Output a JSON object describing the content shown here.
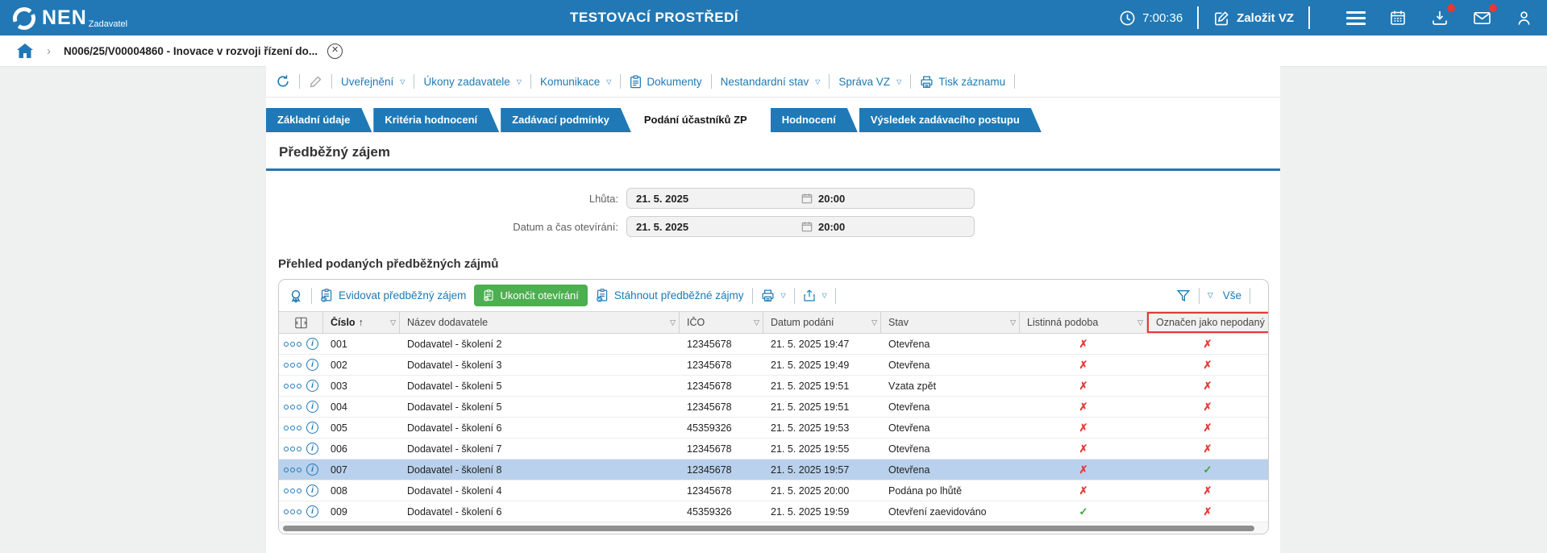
{
  "header": {
    "logo": "NEN",
    "logo_sub": "Zadavatel",
    "env_title": "TESTOVACÍ PROSTŘEDÍ",
    "clock": "7:00:36",
    "create_label": "Založit VZ"
  },
  "breadcrumb": {
    "title": "N006/25/V00004860 - Inovace v rozvoji řízení do..."
  },
  "panel_toolbar": {
    "items": [
      {
        "label": "Uveřejnění",
        "caret": true
      },
      {
        "label": "Úkony zadavatele",
        "caret": true
      },
      {
        "label": "Komunikace",
        "caret": true
      },
      {
        "label": "Dokumenty",
        "caret": false
      },
      {
        "label": "Nestandardní stav",
        "caret": true
      },
      {
        "label": "Správa VZ",
        "caret": true
      },
      {
        "label": "Tisk záznamu",
        "caret": false
      }
    ]
  },
  "tabs": [
    {
      "label": "Základní údaje",
      "active": false
    },
    {
      "label": "Kritéria hodnocení",
      "active": false
    },
    {
      "label": "Zadávací podmínky",
      "active": false
    },
    {
      "label": "Podání účastníků ZP",
      "active": true
    },
    {
      "label": "Hodnocení",
      "active": false
    },
    {
      "label": "Výsledek zadávacího postupu",
      "active": false
    }
  ],
  "sections": {
    "interest_title": "Předběžný zájem",
    "list_title": "Přehled podaných předběžných zájmů"
  },
  "form": {
    "rows": [
      {
        "label": "Lhůta:",
        "date": "21. 5. 2025",
        "time": "20:00"
      },
      {
        "label": "Datum a čas otevírání:",
        "date": "21. 5. 2025",
        "time": "20:00"
      }
    ]
  },
  "card": {
    "toolbar": {
      "register": "Evidovat předběžný zájem",
      "finish": "Ukončit otevírání",
      "download": "Stáhnout předběžné zájmy",
      "all_label": "Vše"
    }
  },
  "table": {
    "columns": [
      {
        "label": "Číslo",
        "sorted": "asc",
        "highlighted": false
      },
      {
        "label": "Název dodavatele",
        "sorted": null,
        "highlighted": false
      },
      {
        "label": "IČO",
        "sorted": null,
        "highlighted": false
      },
      {
        "label": "Datum podání",
        "sorted": null,
        "highlighted": false
      },
      {
        "label": "Stav",
        "sorted": null,
        "highlighted": false
      },
      {
        "label": "Listinná podoba",
        "sorted": null,
        "highlighted": false
      },
      {
        "label": "Označen jako nepodaný",
        "sorted": null,
        "highlighted": true
      }
    ],
    "rows": [
      {
        "cislo": "001",
        "nazev": "Dodavatel - školení 2",
        "ico": "12345678",
        "datum": "21. 5. 2025 19:47",
        "stav": "Otevřena",
        "listinna": false,
        "nepodany": false,
        "selected": false
      },
      {
        "cislo": "002",
        "nazev": "Dodavatel - školení 3",
        "ico": "12345678",
        "datum": "21. 5. 2025 19:49",
        "stav": "Otevřena",
        "listinna": false,
        "nepodany": false,
        "selected": false
      },
      {
        "cislo": "003",
        "nazev": "Dodavatel - školení 5",
        "ico": "12345678",
        "datum": "21. 5. 2025 19:51",
        "stav": "Vzata zpět",
        "listinna": false,
        "nepodany": false,
        "selected": false
      },
      {
        "cislo": "004",
        "nazev": "Dodavatel - školení 5",
        "ico": "12345678",
        "datum": "21. 5. 2025 19:51",
        "stav": "Otevřena",
        "listinna": false,
        "nepodany": false,
        "selected": false
      },
      {
        "cislo": "005",
        "nazev": "Dodavatel - školení 6",
        "ico": "45359326",
        "datum": "21. 5. 2025 19:53",
        "stav": "Otevřena",
        "listinna": false,
        "nepodany": false,
        "selected": false
      },
      {
        "cislo": "006",
        "nazev": "Dodavatel - školení 7",
        "ico": "12345678",
        "datum": "21. 5. 2025 19:55",
        "stav": "Otevřena",
        "listinna": false,
        "nepodany": false,
        "selected": false
      },
      {
        "cislo": "007",
        "nazev": "Dodavatel - školení 8",
        "ico": "12345678",
        "datum": "21. 5. 2025 19:57",
        "stav": "Otevřena",
        "listinna": false,
        "nepodany": true,
        "selected": true
      },
      {
        "cislo": "008",
        "nazev": "Dodavatel - školení 4",
        "ico": "12345678",
        "datum": "21. 5. 2025 20:00",
        "stav": "Podána po lhůtě",
        "listinna": false,
        "nepodany": false,
        "selected": false
      },
      {
        "cislo": "009",
        "nazev": "Dodavatel - školení 6",
        "ico": "45359326",
        "datum": "21. 5. 2025 19:59",
        "stav": "Otevření zaevidováno",
        "listinna": true,
        "nepodany": false,
        "selected": false
      }
    ]
  },
  "icons": {
    "cross": "✗",
    "check": "✓",
    "caret_down": "▽",
    "sort_asc": "↑",
    "chevron_right": "›",
    "close": "✕",
    "info": "i"
  },
  "colors": {
    "accent_blue": "#2178b5",
    "link_blue": "#1d7ab5",
    "green": "#4caf50",
    "red": "#e33b35",
    "selected_row": "#b9d1ec"
  }
}
